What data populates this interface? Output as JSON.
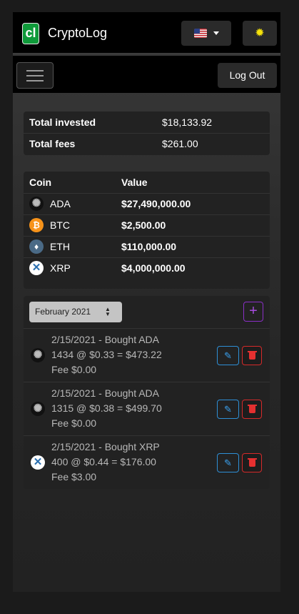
{
  "app": {
    "logo_text": "cl",
    "title": "CryptoLog"
  },
  "header": {
    "language": "en-US",
    "flag_icon": "us-flag-icon",
    "theme_icon": "sun-icon"
  },
  "toolbar": {
    "menu_icon": "hamburger-icon",
    "logout_label": "Log Out"
  },
  "summary": [
    {
      "label": "Total invested",
      "value": "$18,133.92"
    },
    {
      "label": "Total fees",
      "value": "$261.00"
    }
  ],
  "holdings": {
    "headers": [
      "Coin",
      "Value"
    ],
    "rows": [
      {
        "symbol": "ADA",
        "value": "$27,490,000.00",
        "icon": "cardano-icon",
        "color": "#111111"
      },
      {
        "symbol": "BTC",
        "value": "$2,500.00",
        "icon": "bitcoin-icon",
        "color": "#f7931a"
      },
      {
        "symbol": "ETH",
        "value": "$110,000.00",
        "icon": "ethereum-icon",
        "color": "#4a6a86"
      },
      {
        "symbol": "XRP",
        "value": "$4,000,000.00",
        "icon": "ripple-icon",
        "color": "#ffffff"
      }
    ]
  },
  "transactions": {
    "month_selected": "February 2021",
    "add_icon": "plus-icon",
    "items": [
      {
        "title": "2/15/2021 - Bought ADA",
        "detail": "1434 @ $0.33 = $473.22",
        "fee": "Fee $0.00",
        "coin_icon": "cardano-icon"
      },
      {
        "title": "2/15/2021 - Bought ADA",
        "detail": "1315 @ $0.38 = $499.70",
        "fee": "Fee $0.00",
        "coin_icon": "cardano-icon"
      },
      {
        "title": "2/15/2021 - Bought XRP",
        "detail": "400 @ $0.44 = $176.00",
        "fee": "Fee $3.00",
        "coin_icon": "ripple-icon"
      }
    ]
  },
  "colors": {
    "brand": "#0f9a3a",
    "edit": "#2e8fd6",
    "delete": "#d62a2a",
    "add": "#8a2fc7"
  }
}
